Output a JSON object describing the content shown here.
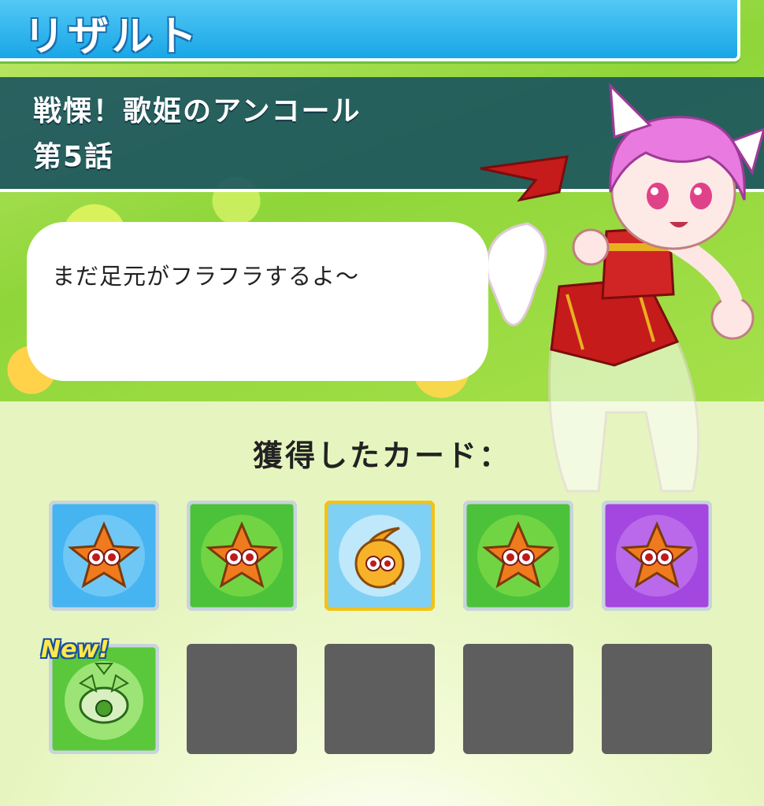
{
  "header": {
    "title": "リザルト"
  },
  "episode": {
    "title": "戦慄！歌姫のアンコール",
    "number": "第5話"
  },
  "dialogue": {
    "text": "まだ足元がフラフラするよ〜"
  },
  "cards_section": {
    "label": "獲得したカード：",
    "row1": [
      {
        "icon": "red-star-puyo-card-icon",
        "theme": "blue"
      },
      {
        "icon": "red-star-puyo-card-icon",
        "theme": "green"
      },
      {
        "icon": "yellow-moon-puyo-card-icon",
        "theme": "gold"
      },
      {
        "icon": "red-star-puyo-card-icon",
        "theme": "green"
      },
      {
        "icon": "red-star-puyo-card-icon",
        "theme": "purple"
      }
    ],
    "row2_first": {
      "icon": "green-candy-puyo-card-icon",
      "badge": "New!"
    },
    "empty_slots": 4
  },
  "colors": {
    "header_blue": "#19a6e6",
    "panel_teal": "#164e60",
    "card_blue": "#46b4f0",
    "card_green": "#4cc23a",
    "card_gold": "#f2c21a",
    "card_purple": "#a347e0",
    "empty_slot": "#5e5e5e"
  }
}
